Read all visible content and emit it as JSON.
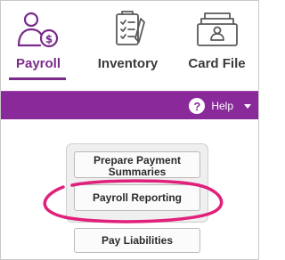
{
  "tabs": [
    {
      "label": "Payroll",
      "icon": "payroll-person-dollar-icon",
      "active": true
    },
    {
      "label": "Inventory",
      "icon": "inventory-clipboard-icon",
      "active": false
    },
    {
      "label": "Card File",
      "icon": "card-file-box-icon",
      "active": false
    }
  ],
  "toolbar": {
    "help_label": "Help",
    "help_icon": "question-circle-icon",
    "menu_icon": "chevron-down-icon"
  },
  "buttons": {
    "prepare_payment_summaries": "Prepare Payment Summaries",
    "payroll_reporting": "Payroll Reporting",
    "pay_liabilities": "Pay Liabilities"
  },
  "colors": {
    "accent": "#8a2a9a",
    "highlight": "#e0207a"
  }
}
